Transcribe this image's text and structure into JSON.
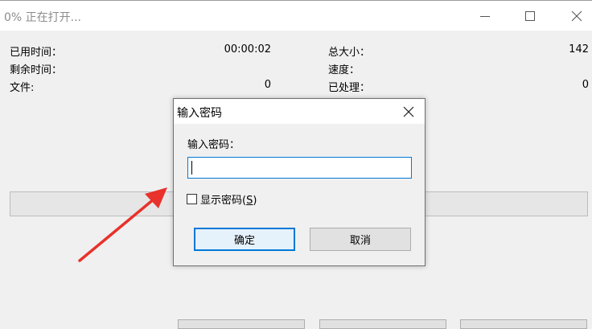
{
  "window": {
    "title": "0% 正在打开...",
    "minimize_icon": "minimize-icon",
    "maximize_icon": "maximize-icon",
    "close_icon": "close-icon"
  },
  "info": {
    "elapsed_label": "已用时间：",
    "elapsed_value": "00:00:02",
    "remaining_label": "剩余时间：",
    "remaining_value": "",
    "files_label": "文件:",
    "files_value": "0",
    "total_size_label": "总大小：",
    "total_size_value": "142",
    "speed_label": "速度：",
    "speed_value": "",
    "processed_label": "已处理：",
    "processed_value": "0"
  },
  "progress": {
    "fraction": 0
  },
  "dialog": {
    "title": "输入密码",
    "close_icon": "close-icon",
    "password_label": "输入密码：",
    "password_value": "",
    "show_password_label_prefix": "显示密码(",
    "show_password_mnemonic": "S",
    "show_password_label_suffix": ")",
    "show_password_checked": false,
    "ok_label": "确定",
    "cancel_label": "取消"
  },
  "colors": {
    "accent": "#0078d7",
    "arrow": "#e8322b"
  }
}
